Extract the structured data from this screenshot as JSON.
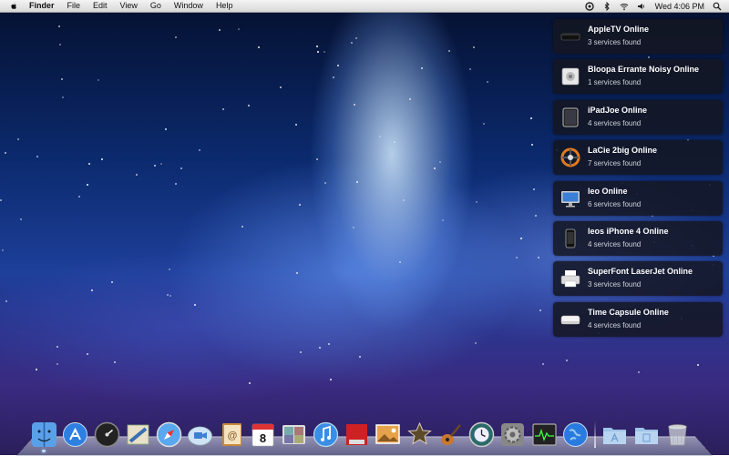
{
  "menubar": {
    "app_name": "Finder",
    "menus": [
      "File",
      "Edit",
      "View",
      "Go",
      "Window",
      "Help"
    ],
    "clock": "Wed 4:06 PM"
  },
  "notifications": [
    {
      "title": "AppleTV Online",
      "subtitle": "3 services found",
      "icon": "appletv-icon"
    },
    {
      "title": "Bloopa Errante Noisy Online",
      "subtitle": "1 services found",
      "icon": "speaker-icon"
    },
    {
      "title": "iPadJoe Online",
      "subtitle": "4 services found",
      "icon": "ipad-icon"
    },
    {
      "title": "LaCie 2big Online",
      "subtitle": "7 services found",
      "icon": "lacie-icon"
    },
    {
      "title": "leo Online",
      "subtitle": "6 services found",
      "icon": "imac-icon"
    },
    {
      "title": "leos iPhone 4 Online",
      "subtitle": "4 services found",
      "icon": "iphone-icon"
    },
    {
      "title": "SuperFont LaserJet Online",
      "subtitle": "3 services found",
      "icon": "printer-icon"
    },
    {
      "title": "Time Capsule Online",
      "subtitle": "4 services found",
      "icon": "time-capsule-icon"
    }
  ],
  "dock": {
    "calendar_day": "8",
    "apps": [
      "finder",
      "app-store",
      "dashboard",
      "mail",
      "safari",
      "facetime",
      "address-book",
      "ical",
      "photo-booth",
      "itunes",
      "photo-app",
      "iphoto",
      "imovie",
      "garageband",
      "time-machine",
      "system-preferences",
      "activity-monitor",
      "network",
      "applications-folder",
      "documents-folder",
      "trash"
    ]
  },
  "colors": {
    "menubar": "#e6e6e6",
    "notification_bg": "#16182a",
    "accent": "#3a7bd5"
  }
}
